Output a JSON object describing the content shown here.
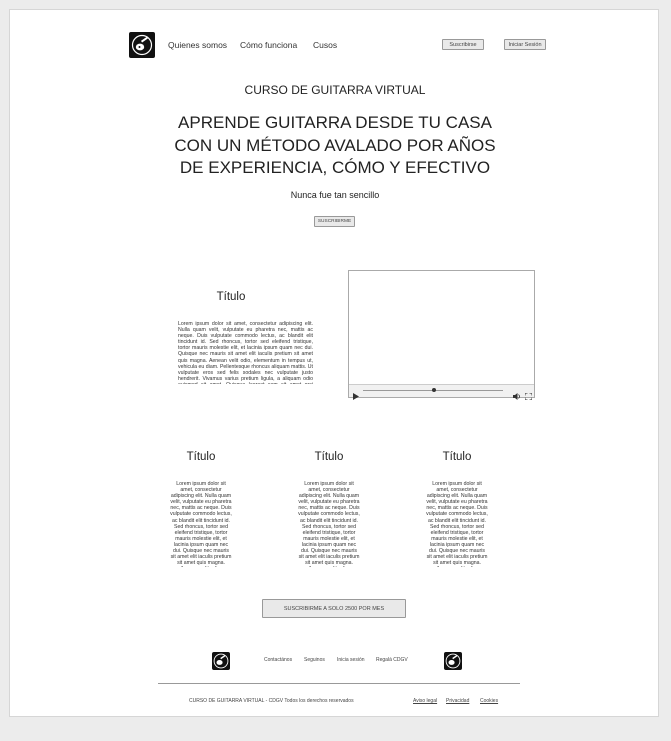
{
  "header": {
    "nav": [
      "Quienes somos",
      "Cómo funciona",
      "Cusos"
    ],
    "subscribe_label": "Suscribirse",
    "login_label": "Iniciar Sesión"
  },
  "hero": {
    "kicker": "CURSO DE GUITARRA VIRTUAL",
    "headline_lines": [
      "APRENDE GUITARRA DESDE TU CASA",
      "CON UN MÉTODO AVALADO POR AÑOS",
      "DE EXPERIENCIA, CÓMO Y EFECTIVO"
    ],
    "tagline": "Nunca fue tan sencillo",
    "cta_label": "SUSCRIBIRME"
  },
  "feature": {
    "title": "Título",
    "body": "Lorem ipsum dolor sit amet, consectetur adipiscing elit. Nulla quam velit, vulputate eu pharetra nec, mattis ac neque. Duis vulputate commodo lectus, ac blandit elit tincidunt id. Sed rhoncus, tortor sed eleifend tristique, tortor mauris molestie elit, et lacinia ipsum quam nec dui. Quisque nec mauris sit amet elit iaculis pretium sit amet quis magna. Aenean velit odio, elementum in tempus ut, vehicula eu diam. Pellentesque rhoncus aliquam mattis. Ut vulputate eros sed felis sodales nec vulputate justo hendrerit. Vivamus varius pretium ligula, a aliquam odio euismod sit amet. Quisque laoreet sem sit amet orci ullamcorper at ultricies metus viverra. Pellentesque arcu mauris."
  },
  "columns": [
    {
      "title": "Título",
      "body": "Lorem ipsum dolor sit amet, consectetur adipiscing elit. Nulla quam velit, vulputate eu pharetra nec, mattis ac neque. Duis vulputate commodo lectus, ac blandit elit tincidunt id. Sed rhoncus, tortor sed eleifend tristique, tortor mauris molestie elit, et lacinia ipsum quam nec dui. Quisque nec mauris sit amet elit iaculis pretium sit amet quis magna. Aenean velit odio, elementum in tempus ut, vehicula eu diam. Pellentesque"
    },
    {
      "title": "Título",
      "body": "Lorem ipsum dolor sit amet, consectetur adipiscing elit. Nulla quam velit, vulputate eu pharetra nec, mattis ac neque. Duis vulputate commodo lectus, ac blandit elit tincidunt id. Sed rhoncus, tortor sed eleifend tristique, tortor mauris molestie elit, et lacinia ipsum quam nec dui. Quisque nec mauris sit amet elit iaculis pretium sit amet quis magna. Aenean velit odio, elementum in tempus ut, vehicula eu diam. Pellentesque"
    },
    {
      "title": "Título",
      "body": "Lorem ipsum dolor sit amet, consectetur adipiscing elit. Nulla quam velit, vulputate eu pharetra nec, mattis ac neque. Duis vulputate commodo lectus, ac blandit elit tincidunt id. Sed rhoncus, tortor sed eleifend tristique, tortor mauris molestie elit, et lacinia ipsum quam nec dui. Quisque nec mauris sit amet elit iaculis pretium sit amet quis magna. Aenean velit odio, elementum in tempus ut, vehicula eu diam. Pellentesque"
    }
  ],
  "subscribe_cta": "SUSCRIBIRME A SOLO 2500 POR MES",
  "footer": {
    "links": [
      "Contactános",
      "Seguinos",
      "Inicia sesión",
      "Regalá CDGV"
    ],
    "copyright": "CURSO DE GUITARRA VIRTUAL - CDGV Todos los derechos reservados",
    "legal": [
      "Aviso legal",
      "Privacidad",
      "Cookies"
    ]
  },
  "icons": {
    "logo": "guitar-logo-icon",
    "video_play": "play-icon",
    "video_volume": "volume-icon",
    "video_fullscreen": "fullscreen-icon"
  }
}
